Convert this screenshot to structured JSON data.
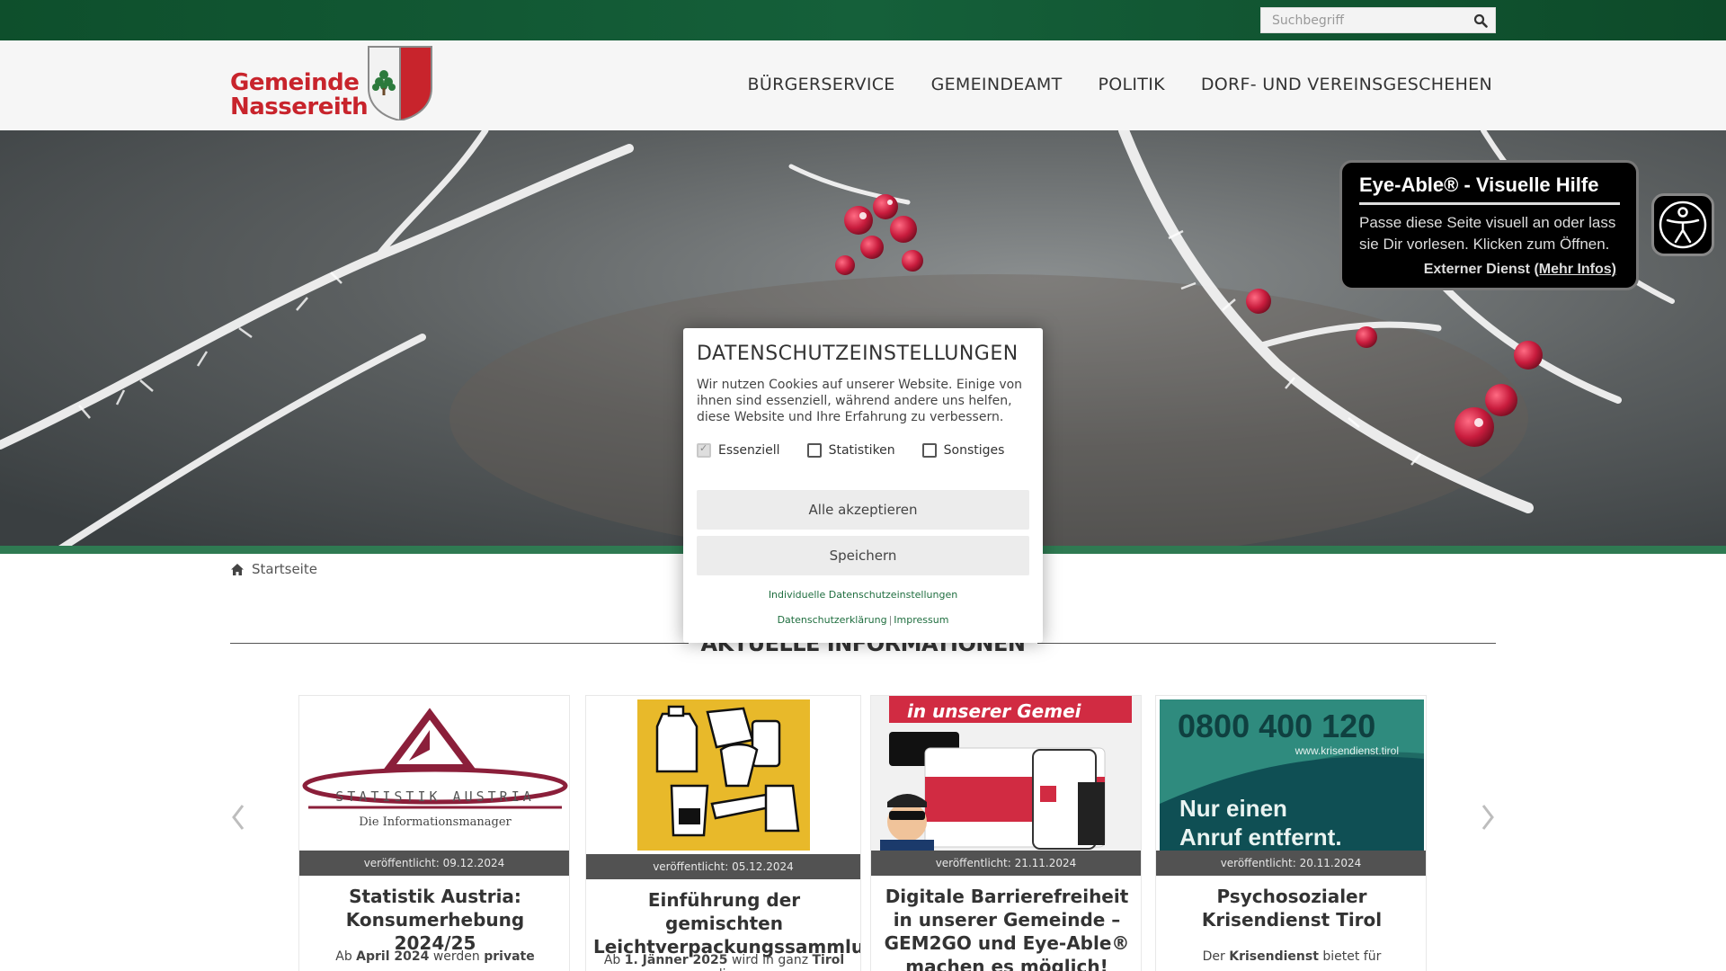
{
  "search": {
    "placeholder": "Suchbegriff"
  },
  "logo": {
    "line1": "Gemeinde",
    "line2": "Nassereith"
  },
  "nav": [
    {
      "label": "BÜRGERSERVICE"
    },
    {
      "label": "GEMEINDEAMT"
    },
    {
      "label": "POLITIK"
    },
    {
      "label": "DORF- UND VEREINSGESCHEHEN"
    }
  ],
  "breadcrumb": {
    "home_label": "Startseite"
  },
  "section": {
    "title": "AKTUELLE INFORMATIONEN"
  },
  "cards": [
    {
      "date": "veröffentlicht: 09.12.2024",
      "title": "Statistik Austria: Konsumerhebung 2024/25",
      "teaser_pre": "Ab ",
      "teaser_b1": "April 2024",
      "teaser_mid": " werden ",
      "teaser_b2": "private",
      "image": {
        "brand": "STATISTIK AUSTRIA",
        "tagline": "Die Informationsmanager"
      }
    },
    {
      "date": "veröffentlicht: 05.12.2024",
      "title": "Einführung der gemischten Leichtverpackungssammlung",
      "teaser_pre": "Ab ",
      "teaser_b1": "1. Jänner 2025",
      "teaser_mid": " wird in ganz ",
      "teaser_b2": "Tirol",
      "teaser_post": " die"
    },
    {
      "date": "veröffentlicht: 21.11.2024",
      "title": "Digitale Barrierefreiheit in unserer Gemeinde – GEM2GO und Eye-Able® machen es möglich!",
      "image": {
        "banner": "in unserer Gemei"
      }
    },
    {
      "date": "veröffentlicht: 20.11.2024",
      "title": "Psychosozialer Krisendienst Tirol",
      "teaser_pre": "Der ",
      "teaser_b1": "Krisendienst",
      "teaser_mid": " bietet für",
      "image": {
        "phone": "0800 400 120",
        "url": "www.krisendienst.tirol",
        "slogan1": "Nur einen",
        "slogan2": "Anruf entfernt."
      }
    }
  ],
  "cookie_modal": {
    "title": "DATENSCHUTZEINSTELLUNGEN",
    "text": "Wir nutzen Cookies auf unserer Website. Einige von ihnen sind essenziell, während andere uns helfen, diese Website und Ihre Erfahrung zu verbessern.",
    "options": [
      {
        "label": "Essenziell",
        "checked": true,
        "disabled": true
      },
      {
        "label": "Statistiken",
        "checked": false
      },
      {
        "label": "Sonstiges",
        "checked": false
      }
    ],
    "accept_all": "Alle akzeptieren",
    "save": "Speichern",
    "individual": "Individuelle Datenschutzeinstellungen",
    "privacy": "Datenschutzerklärung",
    "separator": "|",
    "imprint": "Impressum"
  },
  "eye_able": {
    "title": "Eye-Able® - Visuelle Hilfe",
    "text": "Passe diese Seite visuell an oder lass sie Dir vorlesen. Klicken zum Öffnen.",
    "service": "Externer Dienst ",
    "more": "(Mehr Infos)"
  },
  "colors": {
    "brand_red": "#c8242c",
    "topbar_green": "#15603a",
    "link_green": "#1f6e3f"
  }
}
